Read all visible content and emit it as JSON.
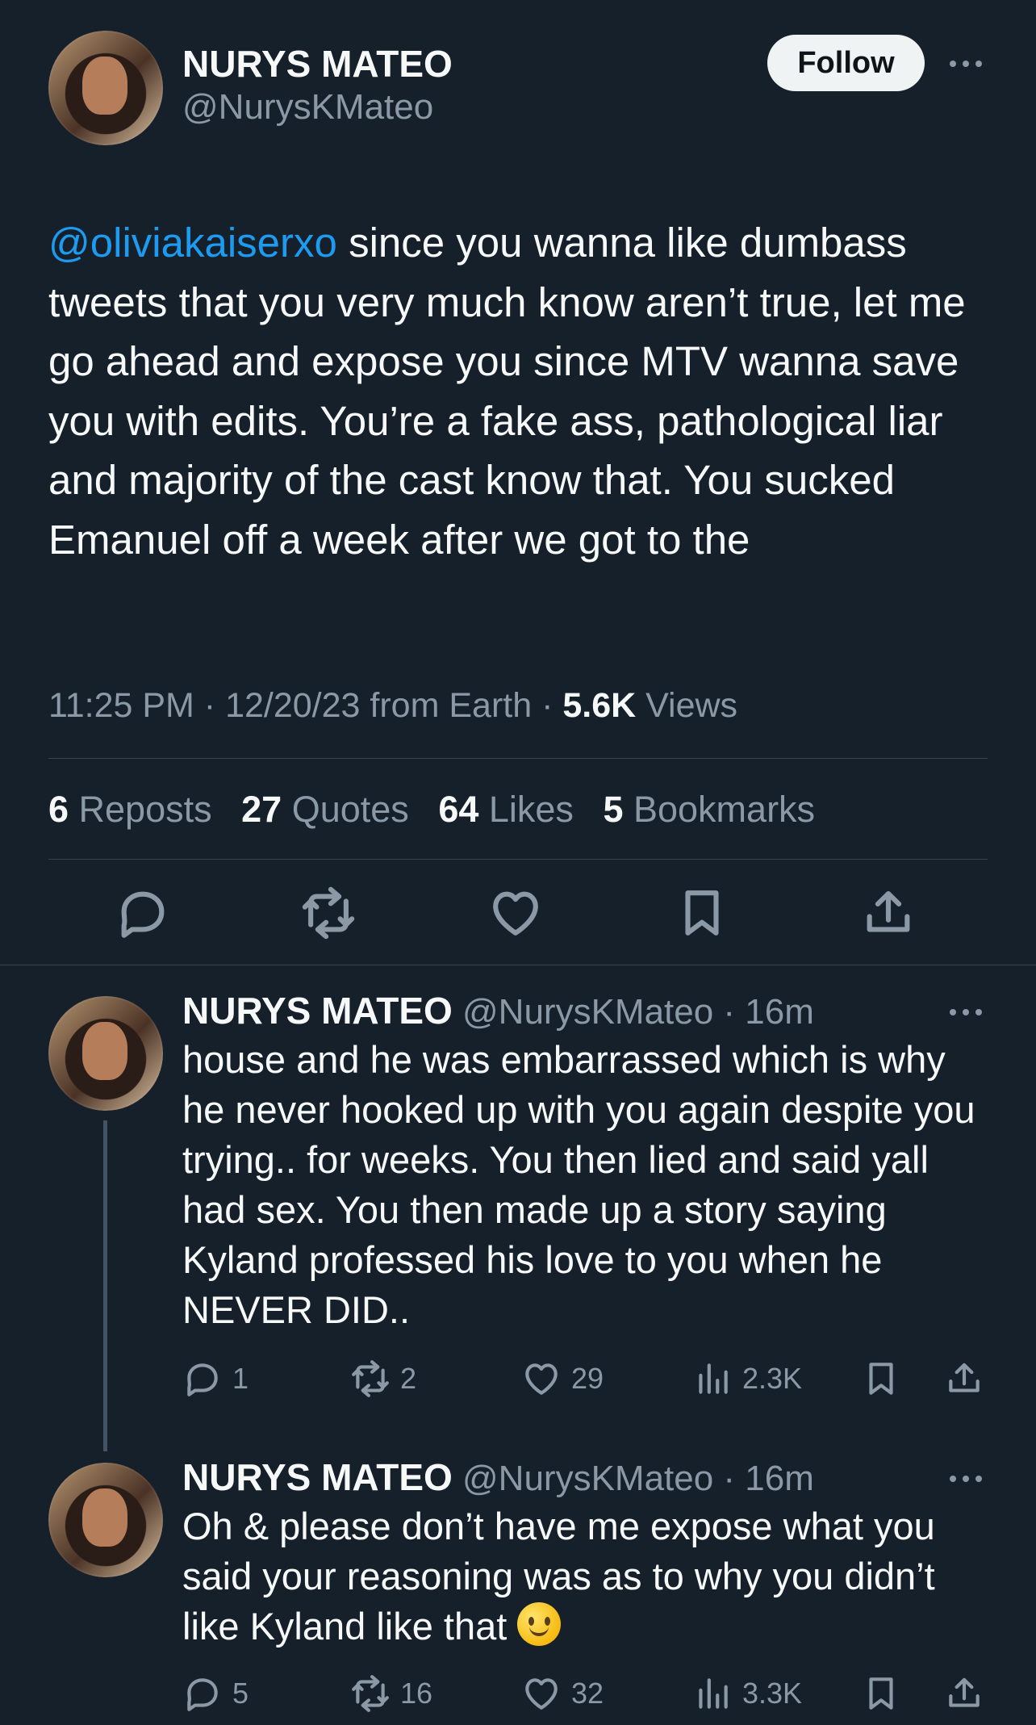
{
  "main_tweet": {
    "author": {
      "display_name": "NURYS MATEO",
      "handle": "@NurysKMateo"
    },
    "follow_label": "Follow",
    "text": {
      "mention": "@oliviakaiserxo",
      "rest": " since you wanna like dumbass tweets that you very much know aren’t true, let me go ahead and expose you since MTV wanna save you with edits. You’re a fake ass, pathological liar and majority of the cast know that. You sucked Emanuel off a week after we got to the"
    },
    "meta": {
      "time_date_source": "11:25 PM · 12/20/23 from Earth · ",
      "views_count": "5.6K",
      "views_label": " Views"
    },
    "stats": {
      "reposts_count": "6",
      "reposts_label": " Reposts",
      "quotes_count": "27",
      "quotes_label": " Quotes",
      "likes_count": "64",
      "likes_label": " Likes",
      "bookmarks_count": "5",
      "bookmarks_label": " Bookmarks"
    },
    "actions": [
      {
        "icon": "reply-icon"
      },
      {
        "icon": "repost-icon"
      },
      {
        "icon": "like-icon"
      },
      {
        "icon": "bookmark-icon"
      },
      {
        "icon": "share-icon"
      }
    ]
  },
  "replies": [
    {
      "display_name": "NURYS MATEO",
      "handle_time": " @NurysKMateo · 16m",
      "text": "house and he was embarrassed which is why he never hooked up with you again despite you trying.. for weeks. You then lied and said yall had sex. You then made up a story saying Kyland professed his love to you when he NEVER DID..",
      "counts": {
        "replies": "1",
        "reposts": "2",
        "likes": "29",
        "views": "2.3K"
      }
    },
    {
      "display_name": "NURYS MATEO",
      "handle_time": " @NurysKMateo · 16m",
      "text": "Oh & please don’t have me expose what you said your reasoning was as to why you didn’t like Kyland like that ",
      "emoji": "slightly-smiling-face-icon",
      "counts": {
        "replies": "5",
        "reposts": "16",
        "likes": "32",
        "views": "3.3K"
      }
    }
  ],
  "colors": {
    "background": "#15202b",
    "primary_text": "#f7f9f9",
    "secondary_text": "#8b98a5",
    "accent_link": "#1d9bf0",
    "divider": "#38444d"
  }
}
